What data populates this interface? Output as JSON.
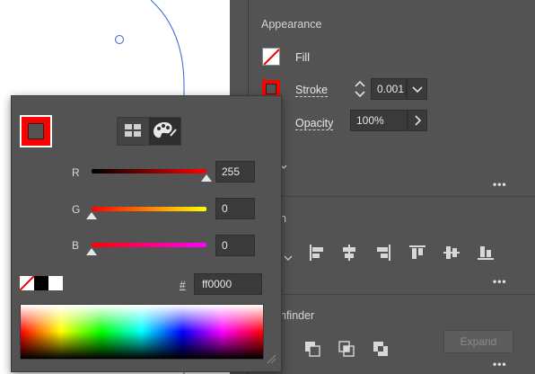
{
  "appearance": {
    "title": "Appearance",
    "fill_label": "Fill",
    "stroke_label": "Stroke",
    "stroke_weight": "0.001",
    "opacity_label": "Opacity",
    "opacity_value": "100%"
  },
  "align": {
    "title": "n"
  },
  "pathfinder": {
    "title": "nfinder",
    "expand_label": "Expand"
  },
  "color_picker": {
    "rgb": [
      {
        "label": "R",
        "value": "255"
      },
      {
        "label": "G",
        "value": "0"
      },
      {
        "label": "B",
        "value": "0"
      }
    ],
    "hash_label": "#",
    "hex_value": "ff0000",
    "mode_icons": [
      "swatches-mode-icon",
      "color-mixer-mode-icon"
    ]
  },
  "colors": {
    "stroke_color": "#ff0000",
    "panel_bg": "#535353",
    "selection_path": "#3b5bdb"
  }
}
